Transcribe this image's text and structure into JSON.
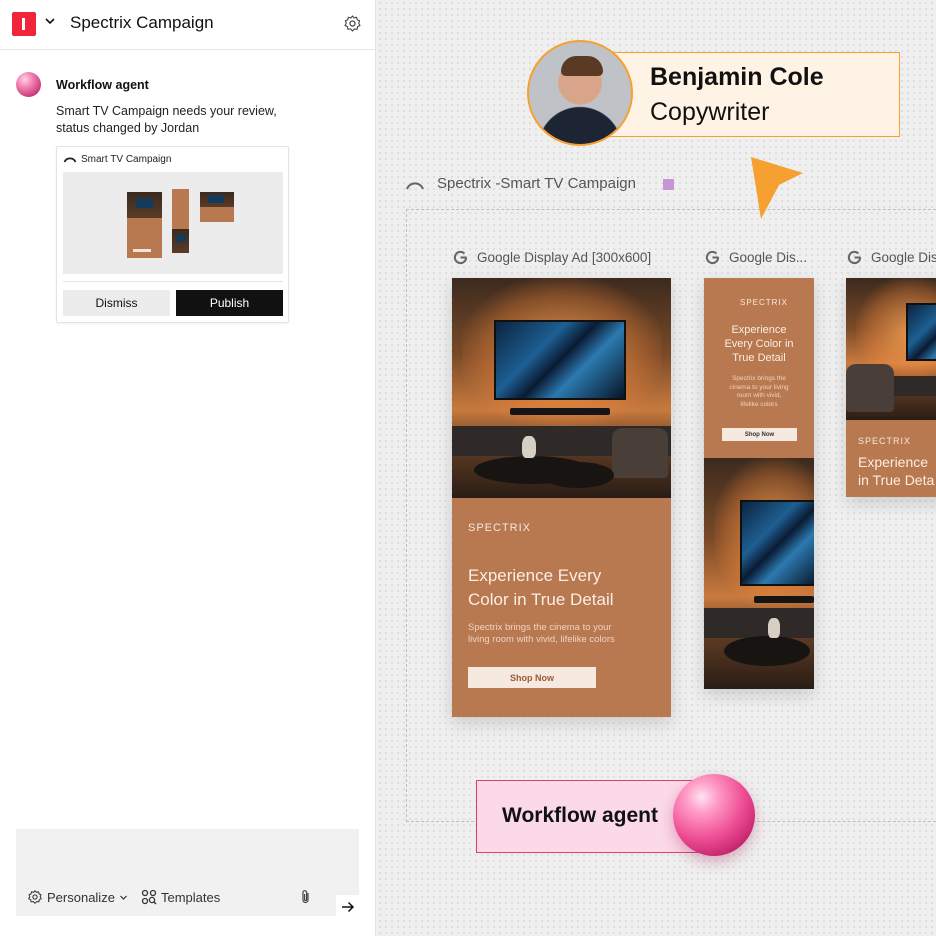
{
  "header": {
    "title": "Spectrix Campaign"
  },
  "chat": {
    "agent_name": "Workflow agent",
    "message_line1": "Smart TV Campaign needs your review,",
    "message_line2": "status changed by Jordan",
    "card": {
      "title": "Smart TV Campaign",
      "dismiss_label": "Dismiss",
      "publish_label": "Publish"
    }
  },
  "composer": {
    "personalize_label": "Personalize",
    "templates_label": "Templates"
  },
  "canvas": {
    "project_title": "Spectrix -Smart TV Campaign",
    "project_color": "#c894d6",
    "ads": [
      {
        "label": "Google Display Ad [300x600]",
        "brand": "SPECTRIX",
        "headline_1": "Experience Every",
        "headline_2": "Color in True Detail",
        "body_1": "Spectrix brings the cinema to your",
        "body_2": "living room with vivid, lifelike colors",
        "cta": "Shop Now"
      },
      {
        "label": "Google Dis...",
        "brand": "SPECTRIX",
        "headline_1": "Experience",
        "headline_2": "Every Color in",
        "headline_3": "True Detail",
        "body_1": "Spectrix brings the",
        "body_2": "cinema to your living",
        "body_3": "room with vivid,",
        "body_4": "lifelike colors",
        "cta": "Shop Now"
      },
      {
        "label": "Google Dis",
        "brand": "SPECTRIX",
        "headline_1": "Experience",
        "headline_2": "in True Deta"
      }
    ],
    "collaborator": {
      "name": "Benjamin Cole",
      "role": "Copywriter",
      "color": "#f5a030"
    },
    "agent_tag": {
      "label": "Workflow agent",
      "color": "#d8416f"
    }
  }
}
